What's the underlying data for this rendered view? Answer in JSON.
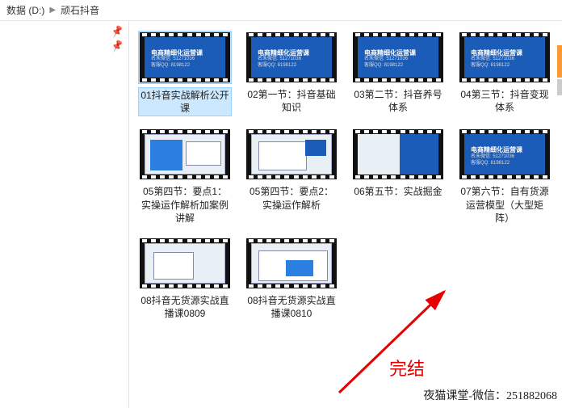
{
  "breadcrumb": {
    "root": "数据 (D:)",
    "current": "顽石抖音"
  },
  "thumb_overlay": {
    "title": "电商精细化运营课",
    "line1": "名朱微信: 51271036",
    "line2": "客服QQ: 8198122"
  },
  "items": [
    {
      "label": "01抖音实战解析公开课",
      "thumb": "blue",
      "selected": true
    },
    {
      "label": "02第一节：抖音基础知识",
      "thumb": "blue"
    },
    {
      "label": "03第二节：抖音养号体系",
      "thumb": "blue"
    },
    {
      "label": "04第三节：抖音变现体系",
      "thumb": "blue"
    },
    {
      "label": "05第四节：要点1：实操运作解析加案例讲解",
      "thumb": "screen1"
    },
    {
      "label": "05第四节：要点2：实操运作解析",
      "thumb": "screen2"
    },
    {
      "label": "06第五节：实战掘金",
      "thumb": "bluestrip"
    },
    {
      "label": "07第六节：自有货源运营模型（大型矩阵）",
      "thumb": "blue"
    },
    {
      "label": "08抖音无货源实战直播课0809",
      "thumb": "screen3"
    },
    {
      "label": "08抖音无货源实战直播课0810",
      "thumb": "screen4"
    }
  ],
  "end_text": "完结",
  "watermark": "夜猫课堂-微信：251882068"
}
